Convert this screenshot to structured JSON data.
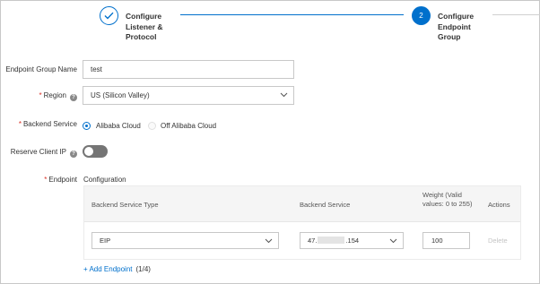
{
  "steps": [
    {
      "number": "",
      "title": "Configure Listener & Protocol",
      "state": "done"
    },
    {
      "number": "2",
      "title": "Configure Endpoint Group",
      "state": "active"
    }
  ],
  "form": {
    "endpoint_group_name": {
      "label": "Endpoint Group Name",
      "value": "test"
    },
    "region": {
      "label": "Region",
      "value": "US (Silicon Valley)"
    },
    "backend_service": {
      "label": "Backend Service",
      "options": [
        {
          "label": "Alibaba Cloud",
          "selected": true
        },
        {
          "label": "Off Alibaba Cloud",
          "selected": false
        }
      ]
    },
    "reserve_client_ip": {
      "label": "Reserve Client IP",
      "enabled": false
    },
    "endpoint": {
      "label": "Endpoint",
      "caption": "Configuration"
    }
  },
  "table": {
    "headers": {
      "type": "Backend Service Type",
      "service": "Backend Service",
      "weight": "Weight (Valid values: 0 to 255)",
      "actions": "Actions"
    },
    "rows": [
      {
        "type": "EIP",
        "service_prefix": "47.",
        "service_suffix": ".154",
        "weight": "100",
        "action": "Delete"
      }
    ]
  },
  "add_endpoint": {
    "label": "+ Add Endpoint",
    "count": "(1/4)"
  },
  "colors": {
    "accent": "#0070cc",
    "required": "#d93026",
    "toggle_off": "#757575"
  }
}
